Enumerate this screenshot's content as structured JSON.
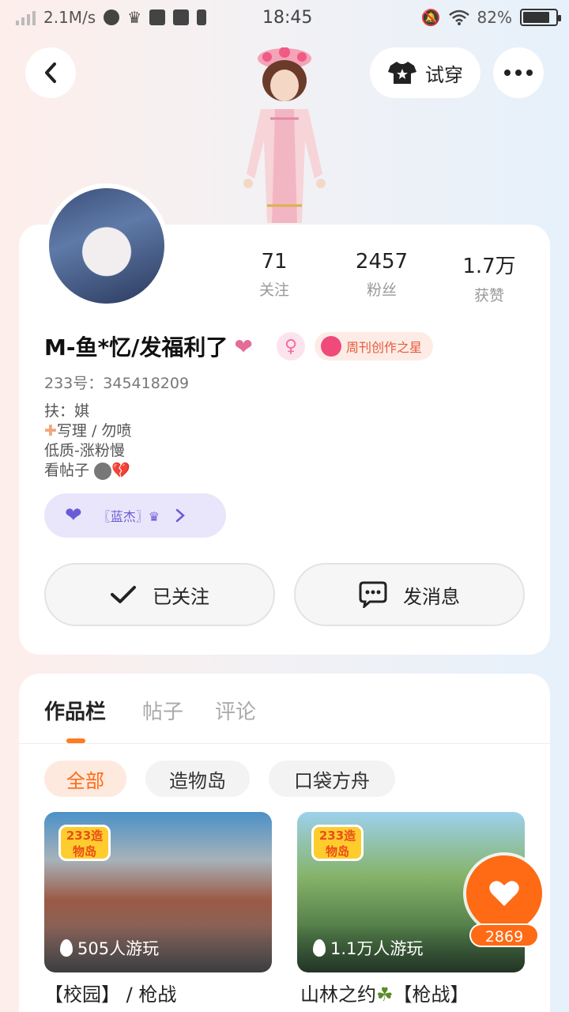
{
  "status_bar": {
    "speed": "2.1M/s",
    "time": "18:45",
    "battery": "82%",
    "battery_level": 0.82
  },
  "header": {
    "try_on_label": "试穿"
  },
  "stats": [
    {
      "value": "71",
      "label": "关注"
    },
    {
      "value": "2457",
      "label": "粉丝"
    },
    {
      "value": "1.7万",
      "label": "获赞"
    }
  ],
  "profile": {
    "name": "M-鱼*忆/发福利了",
    "medal": "周刊创作之星",
    "uid": "233号：345418209",
    "bio_line1": "扶：娸",
    "bio_line2": "写理 / 勿喷",
    "bio_line3": "低质-涨粉慢",
    "bio_line4": "看帖子",
    "clan": "〖蓝杰〗♛"
  },
  "actions": {
    "follow": "已关注",
    "message": "发消息"
  },
  "tabs": [
    "作品栏",
    "帖子",
    "评论"
  ],
  "filters": [
    "全部",
    "造物岛",
    "口袋方舟"
  ],
  "games": [
    {
      "logo": "233造物岛",
      "plays": "505人游玩",
      "title": "【校园】 / 枪战"
    },
    {
      "logo": "233造物岛",
      "plays": "1.1万人游玩",
      "title_prefix": "山林之约",
      "title_suffix": "【枪战】"
    }
  ],
  "favorite": {
    "count": "2869"
  },
  "colors": {
    "accent": "#ff6a14",
    "clan": "#6a5bd6",
    "medal": "#e65a3c"
  }
}
